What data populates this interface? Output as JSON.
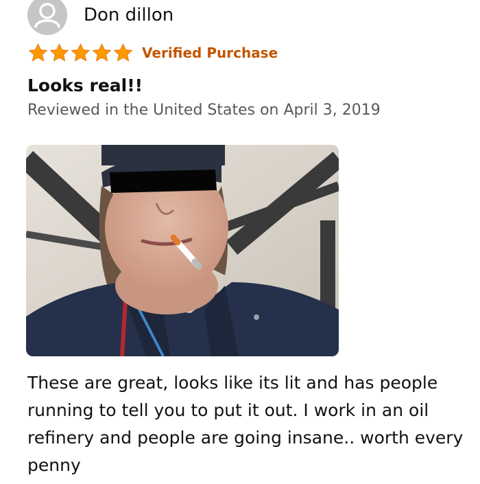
{
  "review": {
    "reviewer_name": "Don dillon",
    "avatar_icon": "user-silhouette-icon",
    "rating": 5,
    "rating_max": 5,
    "star_color": "#ff9900",
    "star_icon": "star-icon",
    "badge": "Verified Purchase",
    "badge_color": "#c45500",
    "title": "Looks real!!",
    "date_line": "Reviewed in the United States on April 3, 2019",
    "body": "These are great, looks like its lit and has people running to tell you to put it out. I work in an oil refinery and people are going insane.. worth every penny"
  }
}
